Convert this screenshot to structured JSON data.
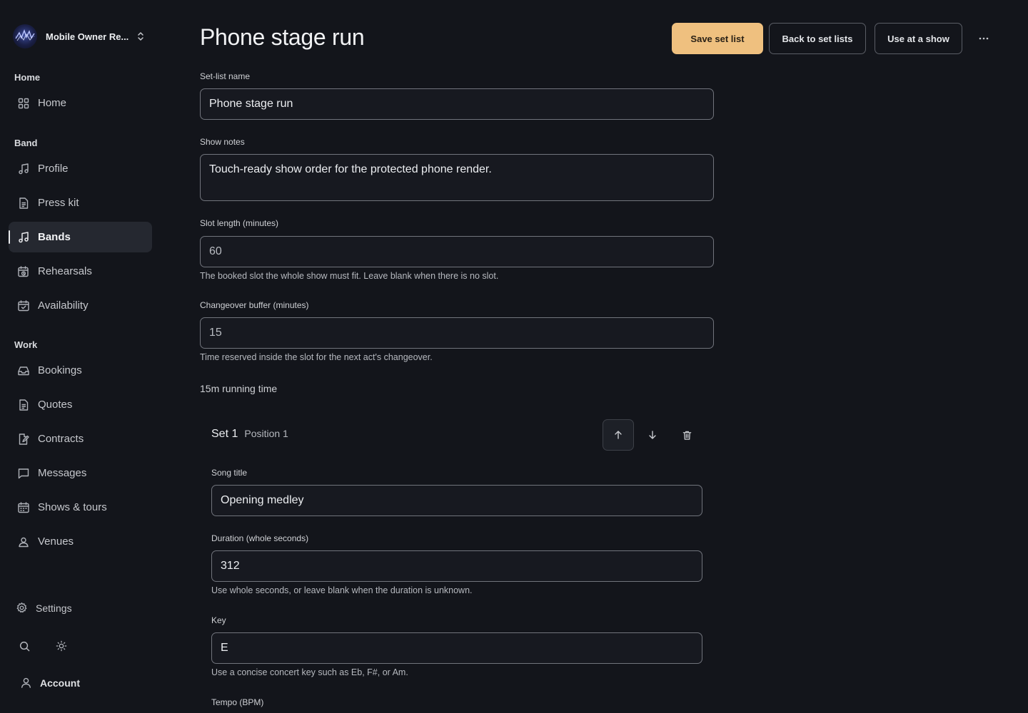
{
  "sidebar": {
    "org_name": "Mobile Owner Re...",
    "sections": {
      "home": "Home",
      "band": "Band",
      "work": "Work"
    },
    "items": {
      "home": "Home",
      "profile": "Profile",
      "press_kit": "Press kit",
      "bands": "Bands",
      "rehearsals": "Rehearsals",
      "availability": "Availability",
      "bookings": "Bookings",
      "quotes": "Quotes",
      "contracts": "Contracts",
      "messages": "Messages",
      "shows_tours": "Shows & tours",
      "venues": "Venues"
    },
    "settings": "Settings",
    "account": "Account",
    "active_item": "bands"
  },
  "header": {
    "title": "Phone stage run",
    "save_label": "Save set list",
    "back_label": "Back to set lists",
    "use_label": "Use at a show"
  },
  "form": {
    "name_label": "Set-list name",
    "name_value": "Phone stage run",
    "notes_label": "Show notes",
    "notes_value": "Touch-ready show order for the protected phone render.",
    "slot_label": "Slot length (minutes)",
    "slot_value": "60",
    "slot_help": "The booked slot the whole show must fit. Leave blank when there is no slot.",
    "buffer_label": "Changeover buffer (minutes)",
    "buffer_value": "15",
    "buffer_help": "Time reserved inside the slot for the next act's changeover.",
    "running_time": "15m running time"
  },
  "song": {
    "set_title": "Set 1",
    "position": "Position 1",
    "title_label": "Song title",
    "title_value": "Opening medley",
    "duration_label": "Duration (whole seconds)",
    "duration_value": "312",
    "duration_help": "Use whole seconds, or leave blank when the duration is unknown.",
    "key_label": "Key",
    "key_value": "E",
    "key_help": "Use a concise concert key such as Eb, F#, or Am.",
    "tempo_label": "Tempo (BPM)"
  },
  "colors": {
    "background": "#13151b",
    "accent": "#efc07f",
    "active_nav": "#252830"
  }
}
